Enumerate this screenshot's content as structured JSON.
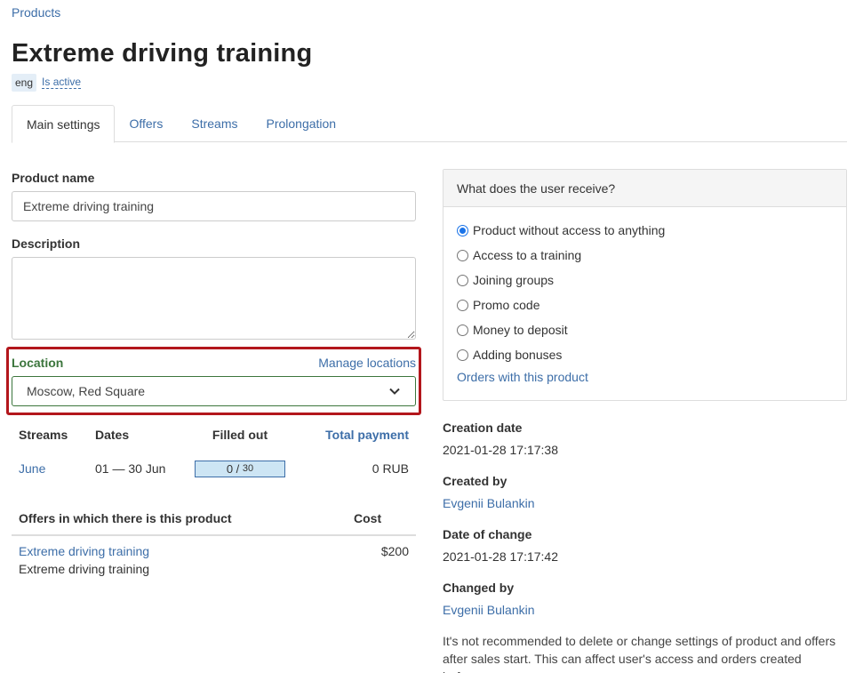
{
  "breadcrumb": "Products",
  "title": "Extreme driving training",
  "lang_badge": "eng",
  "active_status": "Is active",
  "tabs": [
    {
      "label": "Main settings",
      "active": true
    },
    {
      "label": "Offers",
      "active": false
    },
    {
      "label": "Streams",
      "active": false
    },
    {
      "label": "Prolongation",
      "active": false
    }
  ],
  "product_name": {
    "label": "Product name",
    "value": "Extreme driving training"
  },
  "description": {
    "label": "Description",
    "value": ""
  },
  "location": {
    "label": "Location",
    "manage_label": "Manage locations",
    "selected": "Moscow, Red Square"
  },
  "streams_table": {
    "headers": [
      "Streams",
      "Dates",
      "Filled out",
      "Total payment"
    ],
    "rows": [
      {
        "stream": "June",
        "dates": "01 — 30 Jun",
        "filled": "0",
        "capacity": "30",
        "payment": "0 RUB"
      }
    ]
  },
  "offers_table": {
    "headers": [
      "Offers in which there is this product",
      "Cost"
    ],
    "rows": [
      {
        "name": "Extreme driving training",
        "subtitle": "Extreme driving training",
        "cost": "$200"
      }
    ]
  },
  "receive_panel": {
    "title": "What does the user receive?",
    "options": [
      {
        "label": "Product without access to anything",
        "checked": true
      },
      {
        "label": "Access to a training",
        "checked": false
      },
      {
        "label": "Joining groups",
        "checked": false
      },
      {
        "label": "Promo code",
        "checked": false
      },
      {
        "label": "Money to deposit",
        "checked": false
      },
      {
        "label": "Adding bonuses",
        "checked": false
      }
    ],
    "orders_link": "Orders with this product"
  },
  "meta": {
    "creation_date_label": "Creation date",
    "creation_date": "2021-01-28 17:17:38",
    "created_by_label": "Created by",
    "created_by": "Evgenii Bulankin",
    "change_date_label": "Date of change",
    "change_date": "2021-01-28 17:17:42",
    "changed_by_label": "Changed by",
    "changed_by": "Evgenii Bulankin"
  },
  "warning_note": "It's not recommended to delete or change settings of product and offers after sales start. This can affect user's access and orders created before.",
  "colors": {
    "link": "#3d6ea8",
    "highlight_border": "#b3161c",
    "location_green": "#3c763d",
    "progress_fill": "#cde5f4"
  }
}
